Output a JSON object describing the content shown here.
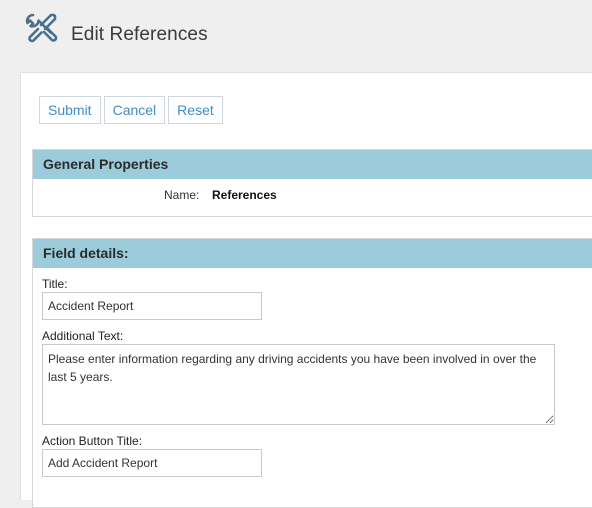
{
  "header": {
    "icon": "tools-icon",
    "title": "Edit References"
  },
  "toolbar": {
    "submit_label": "Submit",
    "cancel_label": "Cancel",
    "reset_label": "Reset"
  },
  "general_properties": {
    "heading": "General Properties",
    "name_label": "Name:",
    "name_value": "References"
  },
  "field_details": {
    "heading": "Field details:",
    "title_label": "Title:",
    "title_value": "Accident Report",
    "additional_text_label": "Additional Text:",
    "additional_text_value": "Please enter information regarding any driving accidents you have been involved in over the last 5 years.",
    "action_button_title_label": "Action Button Title:",
    "action_button_title_value": "Add Accident Report"
  },
  "colors": {
    "section_header": "#9ccbdc",
    "link_blue": "#3d8ec9"
  }
}
